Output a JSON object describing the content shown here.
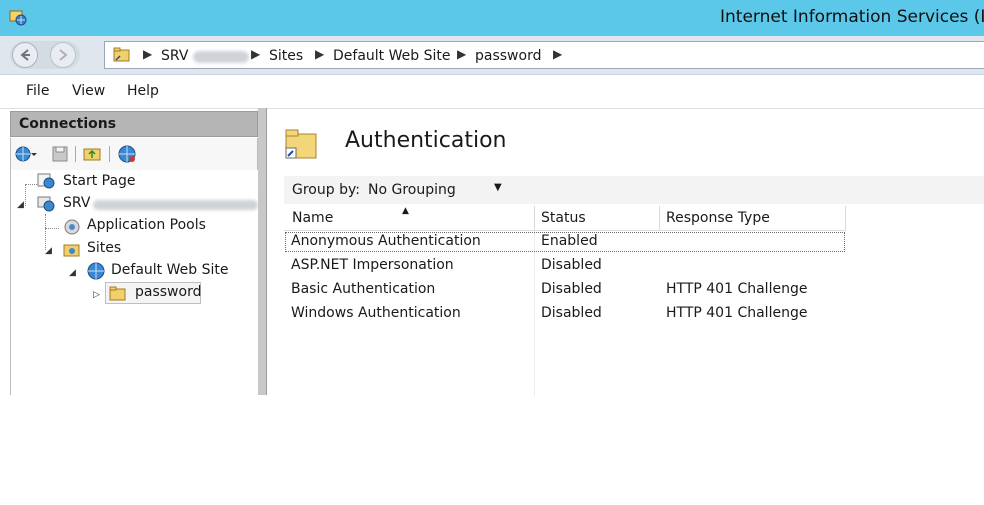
{
  "titlebar": {
    "title": "Internet Information Services (IIS"
  },
  "breadcrumb": {
    "items": [
      "SRV",
      "Sites",
      "Default Web Site",
      "password"
    ]
  },
  "menu": {
    "items": [
      "File",
      "View",
      "Help"
    ]
  },
  "connections": {
    "title": "Connections",
    "tree": {
      "start_page": "Start Page",
      "server": "SRV",
      "app_pools": "Application Pools",
      "sites": "Sites",
      "default_site": "Default Web Site",
      "password": "password"
    }
  },
  "main": {
    "title": "Authentication",
    "group_by_label": "Group by:",
    "group_by_value": "No Grouping",
    "columns": [
      "Name",
      "Status",
      "Response Type"
    ],
    "rows": [
      {
        "name": "Anonymous Authentication",
        "status": "Enabled",
        "response": ""
      },
      {
        "name": "ASP.NET Impersonation",
        "status": "Disabled",
        "response": ""
      },
      {
        "name": "Basic Authentication",
        "status": "Disabled",
        "response": "HTTP 401 Challenge"
      },
      {
        "name": "Windows Authentication",
        "status": "Disabled",
        "response": "HTTP 401 Challenge"
      }
    ]
  },
  "colors": {
    "titlebar": "#5bc8ea",
    "navbar": "#dfe6ee",
    "panel_header": "#b5b5b5"
  },
  "icons": [
    "iis-app-icon",
    "back-arrow-icon",
    "forward-arrow-icon",
    "folder-shortcut-icon",
    "globe-connect-icon",
    "save-icon",
    "folder-up-icon",
    "globe-network-icon",
    "start-page-icon",
    "server-icon",
    "app-pool-icon",
    "sites-folder-icon",
    "globe-site-icon",
    "folder-icon",
    "authentication-folder-icon",
    "dropdown-arrow-icon",
    "sort-up-icon"
  ]
}
